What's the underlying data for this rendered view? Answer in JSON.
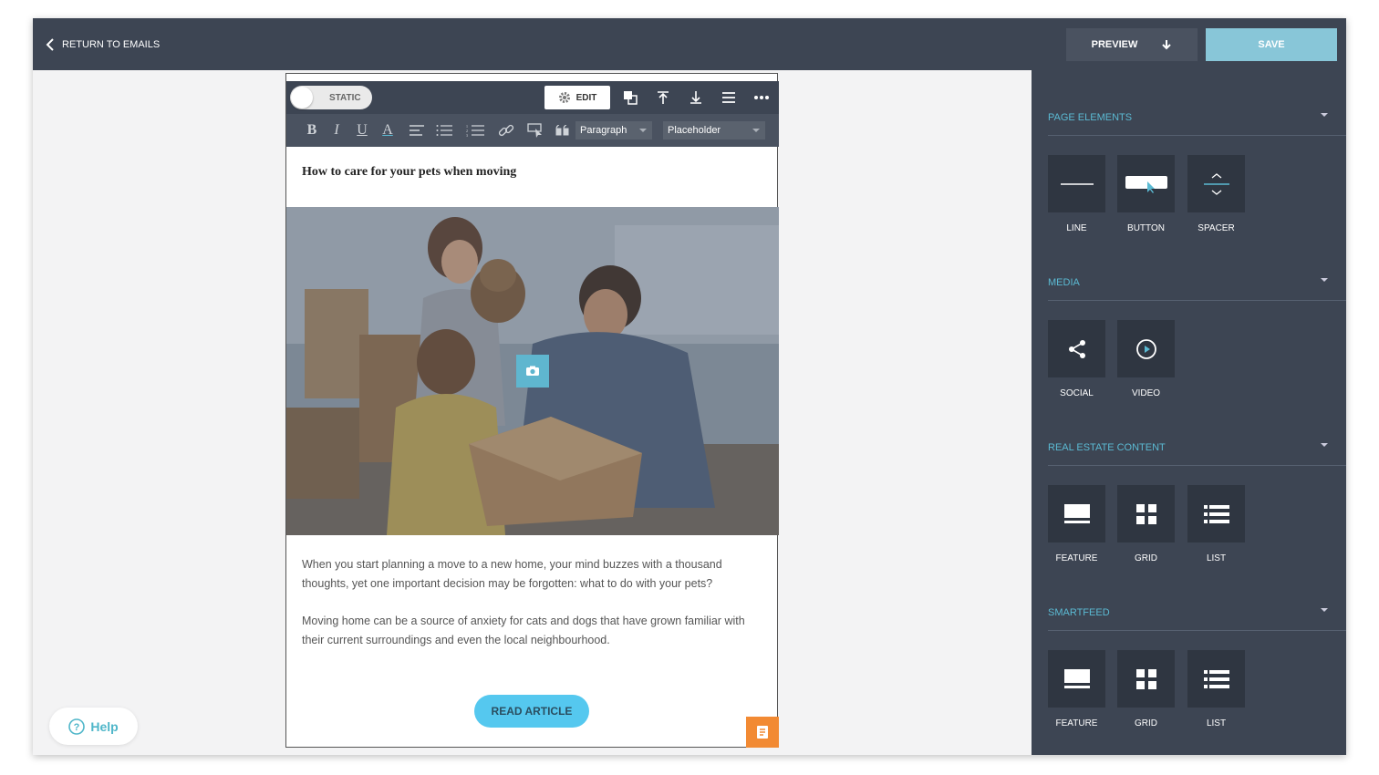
{
  "topbar": {
    "back_label": "RETURN TO EMAILS",
    "preview_label": "PREVIEW",
    "save_label": "SAVE"
  },
  "editor_toolbar": {
    "toggle_label": "STATIC",
    "edit_label": "EDIT",
    "icons": [
      "duplicate-icon",
      "move-up-icon",
      "move-down-icon",
      "menu-icon",
      "more-icon"
    ]
  },
  "format_toolbar": {
    "bold": "B",
    "italic": "I",
    "underline": "U",
    "font_color": "A",
    "block_style": "Paragraph",
    "placeholder_select": "Placeholder"
  },
  "email": {
    "headline": "How to care for your pets when moving",
    "paragraphs": [
      "When you start planning a move to a new home, your mind buzzes with a thousand thoughts, yet one important decision may be forgotten: what to do with your pets?",
      "Moving home can be a source of anxiety for cats and dogs that have grown familiar with their current surroundings and even the local neighbourhood."
    ],
    "button_label": "READ ARTICLE"
  },
  "help_label": "Help",
  "sidebar": {
    "sections": [
      {
        "title": "PAGE ELEMENTS",
        "items": [
          "LINE",
          "BUTTON",
          "SPACER"
        ]
      },
      {
        "title": "MEDIA",
        "items": [
          "SOCIAL",
          "VIDEO"
        ]
      },
      {
        "title": "REAL ESTATE CONTENT",
        "items": [
          "FEATURE",
          "GRID",
          "LIST"
        ]
      },
      {
        "title": "SMARTFEED",
        "items": [
          "FEATURE",
          "GRID",
          "LIST"
        ]
      }
    ]
  },
  "colors": {
    "topbar": "#3d4553",
    "save": "#88c6d8",
    "accent": "#5bbad3",
    "read_button": "#55c8ef",
    "note_button": "#f28a33"
  }
}
